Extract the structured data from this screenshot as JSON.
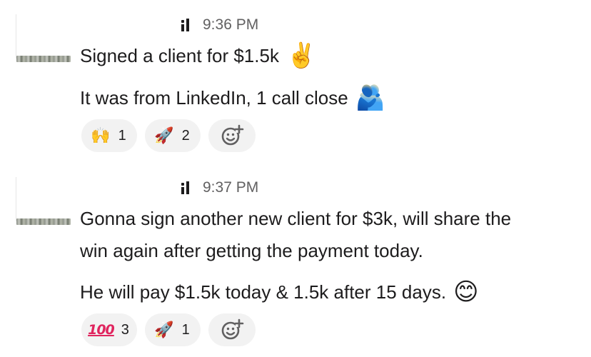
{
  "messages": [
    {
      "time": "9:36 PM",
      "lines": [
        {
          "text": "Signed a client for $1.5k",
          "emoji": "✌️",
          "emoji_name": "victory-hand-icon"
        },
        {
          "text": "It was from LinkedIn, 1 call close",
          "emoji": "🫂",
          "emoji_name": "people-hugging-icon"
        }
      ],
      "reactions": [
        {
          "emoji": "🙌",
          "name": "raising-hands-icon",
          "count": "1"
        },
        {
          "emoji": "🚀",
          "name": "rocket-icon",
          "count": "2"
        }
      ]
    },
    {
      "time": "9:37 PM",
      "lines": [
        {
          "text": "Gonna sign another new client for $3k, will share the",
          "emoji": "",
          "emoji_name": ""
        },
        {
          "text": "win again after getting the payment today.",
          "emoji": "",
          "emoji_name": ""
        },
        {
          "text": "He will pay $1.5k today & 1.5k after 15 days.",
          "emoji": "😊",
          "emoji_name": "smiling-face-icon"
        }
      ],
      "reactions": [
        {
          "emoji": "100",
          "name": "hundred-points-icon",
          "count": "3"
        },
        {
          "emoji": "🚀",
          "name": "rocket-icon",
          "count": "1"
        }
      ]
    }
  ],
  "colors": {
    "text": "#1d1c1d",
    "timestamp": "#616061",
    "reaction_bg": "#f2f2f2",
    "hundred_red": "#e0245e"
  }
}
